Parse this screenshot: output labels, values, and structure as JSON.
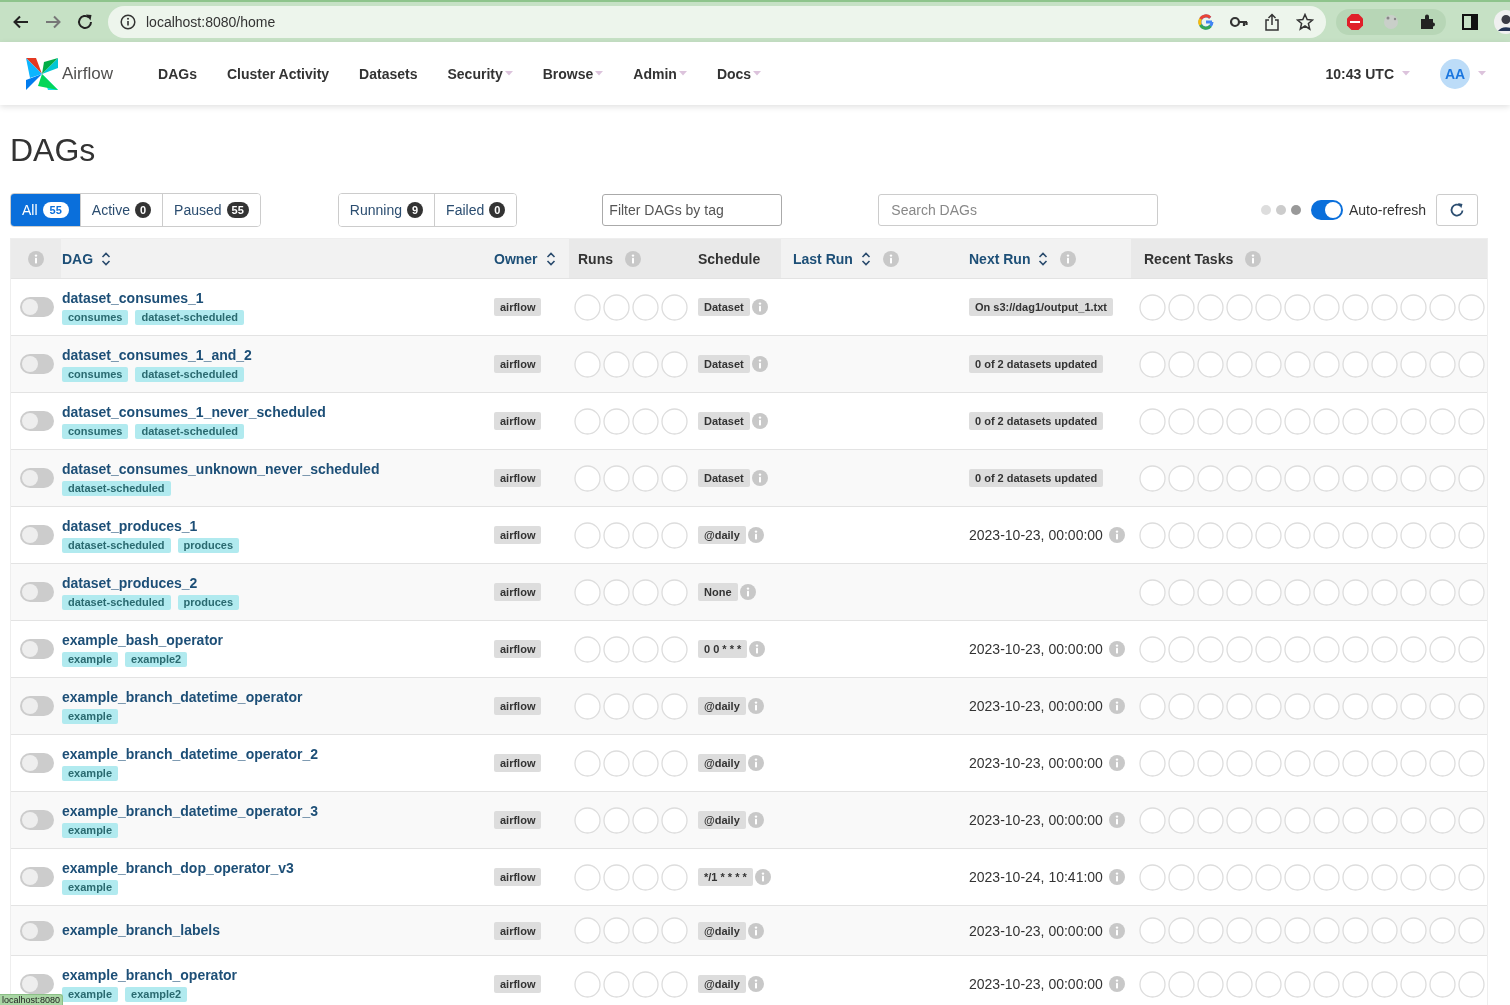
{
  "browser": {
    "url": "localhost:8080/home"
  },
  "nav": {
    "brand": "Airflow",
    "items": [
      {
        "label": "DAGs",
        "dropdown": false
      },
      {
        "label": "Cluster Activity",
        "dropdown": false
      },
      {
        "label": "Datasets",
        "dropdown": false
      },
      {
        "label": "Security",
        "dropdown": true
      },
      {
        "label": "Browse",
        "dropdown": true
      },
      {
        "label": "Admin",
        "dropdown": true
      },
      {
        "label": "Docs",
        "dropdown": true
      }
    ],
    "clock": "10:43 UTC",
    "user": "AA"
  },
  "page": {
    "title": "DAGs"
  },
  "status_filters": [
    {
      "label": "All",
      "count": "55",
      "selected": true
    },
    {
      "label": "Active",
      "count": "0",
      "selected": false
    },
    {
      "label": "Paused",
      "count": "55",
      "selected": false
    }
  ],
  "run_filters": [
    {
      "label": "Running",
      "count": "9"
    },
    {
      "label": "Failed",
      "count": "0"
    }
  ],
  "tag_filter": {
    "placeholder": "Filter DAGs by tag"
  },
  "search": {
    "placeholder": "Search DAGs"
  },
  "auto_refresh": {
    "label": "Auto-refresh",
    "on": true
  },
  "table": {
    "columns": [
      {
        "label": "DAG",
        "sortable": true,
        "info": false
      },
      {
        "label": "Owner",
        "sortable": true,
        "info": false
      },
      {
        "label": "Runs",
        "sortable": false,
        "info": true
      },
      {
        "label": "Schedule",
        "sortable": false,
        "info": false
      },
      {
        "label": "Last Run",
        "sortable": true,
        "info": true
      },
      {
        "label": "Next Run",
        "sortable": true,
        "info": true
      },
      {
        "label": "Recent Tasks",
        "sortable": false,
        "info": true
      }
    ],
    "rows": [
      {
        "name": "dataset_consumes_1",
        "active": false,
        "tags": [
          "consumes",
          "dataset-scheduled"
        ],
        "owner": "airflow",
        "schedule": "Dataset",
        "next_run": {
          "kind": "dataset",
          "text": "On s3://dag1/output_1.txt"
        }
      },
      {
        "name": "dataset_consumes_1_and_2",
        "active": false,
        "tags": [
          "consumes",
          "dataset-scheduled"
        ],
        "owner": "airflow",
        "schedule": "Dataset",
        "next_run": {
          "kind": "dataset",
          "text": "0 of 2 datasets updated"
        }
      },
      {
        "name": "dataset_consumes_1_never_scheduled",
        "active": false,
        "tags": [
          "consumes",
          "dataset-scheduled"
        ],
        "owner": "airflow",
        "schedule": "Dataset",
        "next_run": {
          "kind": "dataset",
          "text": "0 of 2 datasets updated"
        }
      },
      {
        "name": "dataset_consumes_unknown_never_scheduled",
        "active": false,
        "tags": [
          "dataset-scheduled"
        ],
        "owner": "airflow",
        "schedule": "Dataset",
        "next_run": {
          "kind": "dataset",
          "text": "0 of 2 datasets updated"
        }
      },
      {
        "name": "dataset_produces_1",
        "active": false,
        "tags": [
          "dataset-scheduled",
          "produces"
        ],
        "owner": "airflow",
        "schedule": "@daily",
        "next_run": {
          "kind": "date",
          "text": "2023-10-23, 00:00:00"
        }
      },
      {
        "name": "dataset_produces_2",
        "active": false,
        "tags": [
          "dataset-scheduled",
          "produces"
        ],
        "owner": "airflow",
        "schedule": "None"
      },
      {
        "name": "example_bash_operator",
        "active": false,
        "tags": [
          "example",
          "example2"
        ],
        "owner": "airflow",
        "schedule": "0 0 * * *",
        "next_run": {
          "kind": "date",
          "text": "2023-10-23, 00:00:00"
        }
      },
      {
        "name": "example_branch_datetime_operator",
        "active": false,
        "tags": [
          "example"
        ],
        "owner": "airflow",
        "schedule": "@daily",
        "next_run": {
          "kind": "date",
          "text": "2023-10-23, 00:00:00"
        }
      },
      {
        "name": "example_branch_datetime_operator_2",
        "active": false,
        "tags": [
          "example"
        ],
        "owner": "airflow",
        "schedule": "@daily",
        "next_run": {
          "kind": "date",
          "text": "2023-10-23, 00:00:00"
        }
      },
      {
        "name": "example_branch_datetime_operator_3",
        "active": false,
        "tags": [
          "example"
        ],
        "owner": "airflow",
        "schedule": "@daily",
        "next_run": {
          "kind": "date",
          "text": "2023-10-23, 00:00:00"
        }
      },
      {
        "name": "example_branch_dop_operator_v3",
        "active": false,
        "tags": [
          "example"
        ],
        "owner": "airflow",
        "schedule": "*/1 * * * *",
        "next_run": {
          "kind": "date",
          "text": "2023-10-24, 10:41:00"
        }
      },
      {
        "name": "example_branch_labels",
        "active": false,
        "tags": [],
        "owner": "airflow",
        "schedule": "@daily",
        "next_run": {
          "kind": "date",
          "text": "2023-10-23, 00:00:00"
        }
      },
      {
        "name": "example_branch_operator",
        "active": false,
        "tags": [
          "example",
          "example2"
        ],
        "owner": "airflow",
        "schedule": "@daily",
        "next_run": {
          "kind": "date",
          "text": "2023-10-23, 00:00:00"
        }
      }
    ]
  },
  "status_tooltip": "localhost:8080"
}
